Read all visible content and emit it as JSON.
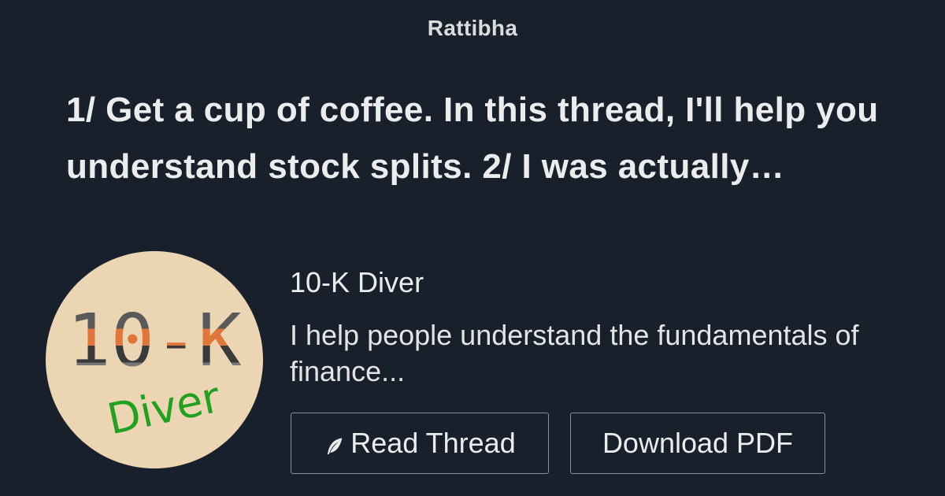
{
  "brand": "Rattibha",
  "headline": "1/ Get a cup of coffee. In this thread, I'll help you understand stock splits. 2/ I was actually…",
  "author": {
    "name": "10-K Diver",
    "bio": "I help people understand the fundamentals of finance...",
    "avatar": {
      "line1": "10-K",
      "line2": "Diver",
      "background": "#ecd5b3",
      "accent_orange": "#e0763a",
      "accent_green": "#22a020",
      "dark_gray": "#5a5a5a"
    }
  },
  "buttons": {
    "read_thread": "Read Thread",
    "read_icon": "feather-icon",
    "download_pdf": "Download PDF"
  },
  "colors": {
    "background": "#18202b",
    "text": "#ececec",
    "button_border": "#8a8f96"
  }
}
